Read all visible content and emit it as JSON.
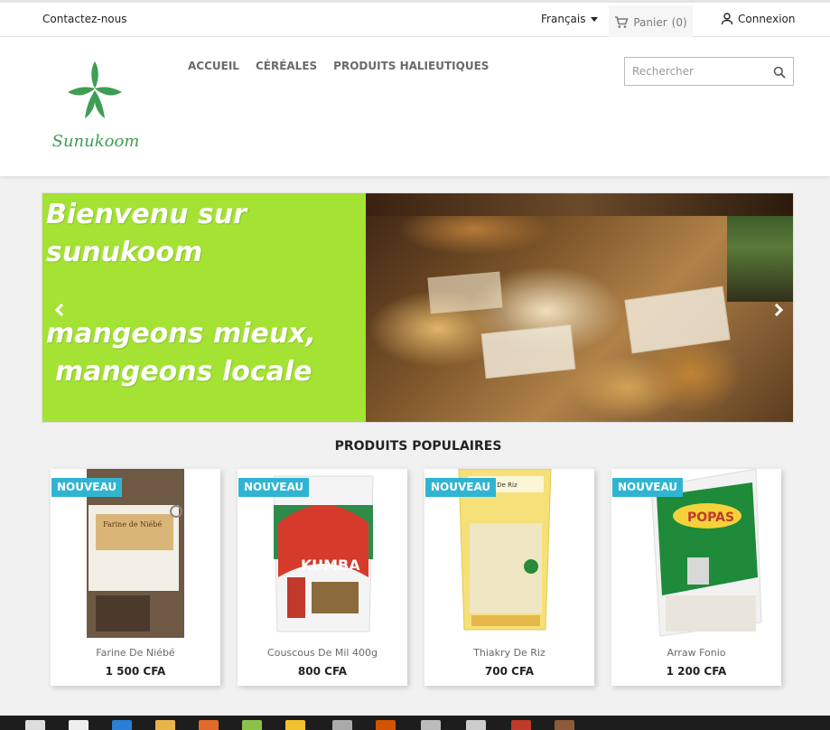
{
  "topnav": {
    "contact": "Contactez-nous",
    "language": "Français",
    "cart_label": "Panier",
    "cart_count": "(0)",
    "login": "Connexion"
  },
  "header": {
    "logo_text": "Sunukoom",
    "menu": [
      "ACCUEIL",
      "CÉRÉALES",
      "PRODUITS HALIEUTIQUES"
    ],
    "search_placeholder": "Rechercher"
  },
  "slider": {
    "line1": "Bienvenu sur",
    "line2": "sunukoom",
    "line3": "mangeons mieux,",
    "line4": "mangeons locale"
  },
  "products": {
    "title": "PRODUITS POPULAIRES",
    "items": [
      {
        "badge": "NOUVEAU",
        "name": "Farine De Niébé",
        "price": "1 500 CFA",
        "package_label": "Farine de Niébé"
      },
      {
        "badge": "NOUVEAU",
        "name": "Couscous De Mil 400g",
        "price": "800 CFA",
        "package_label": "KUMBA"
      },
      {
        "badge": "NOUVEAU",
        "name": "Thiakry De Riz",
        "price": "700 CFA",
        "package_label": "Thiakry De Riz"
      },
      {
        "badge": "NOUVEAU",
        "name": "Arraw Fonio",
        "price": "1 200 CFA",
        "package_label": "POPAS"
      }
    ]
  },
  "colors": {
    "accent": "#2fb5d2",
    "slide_green": "#a4e234",
    "logo_green": "#3e9e54"
  }
}
